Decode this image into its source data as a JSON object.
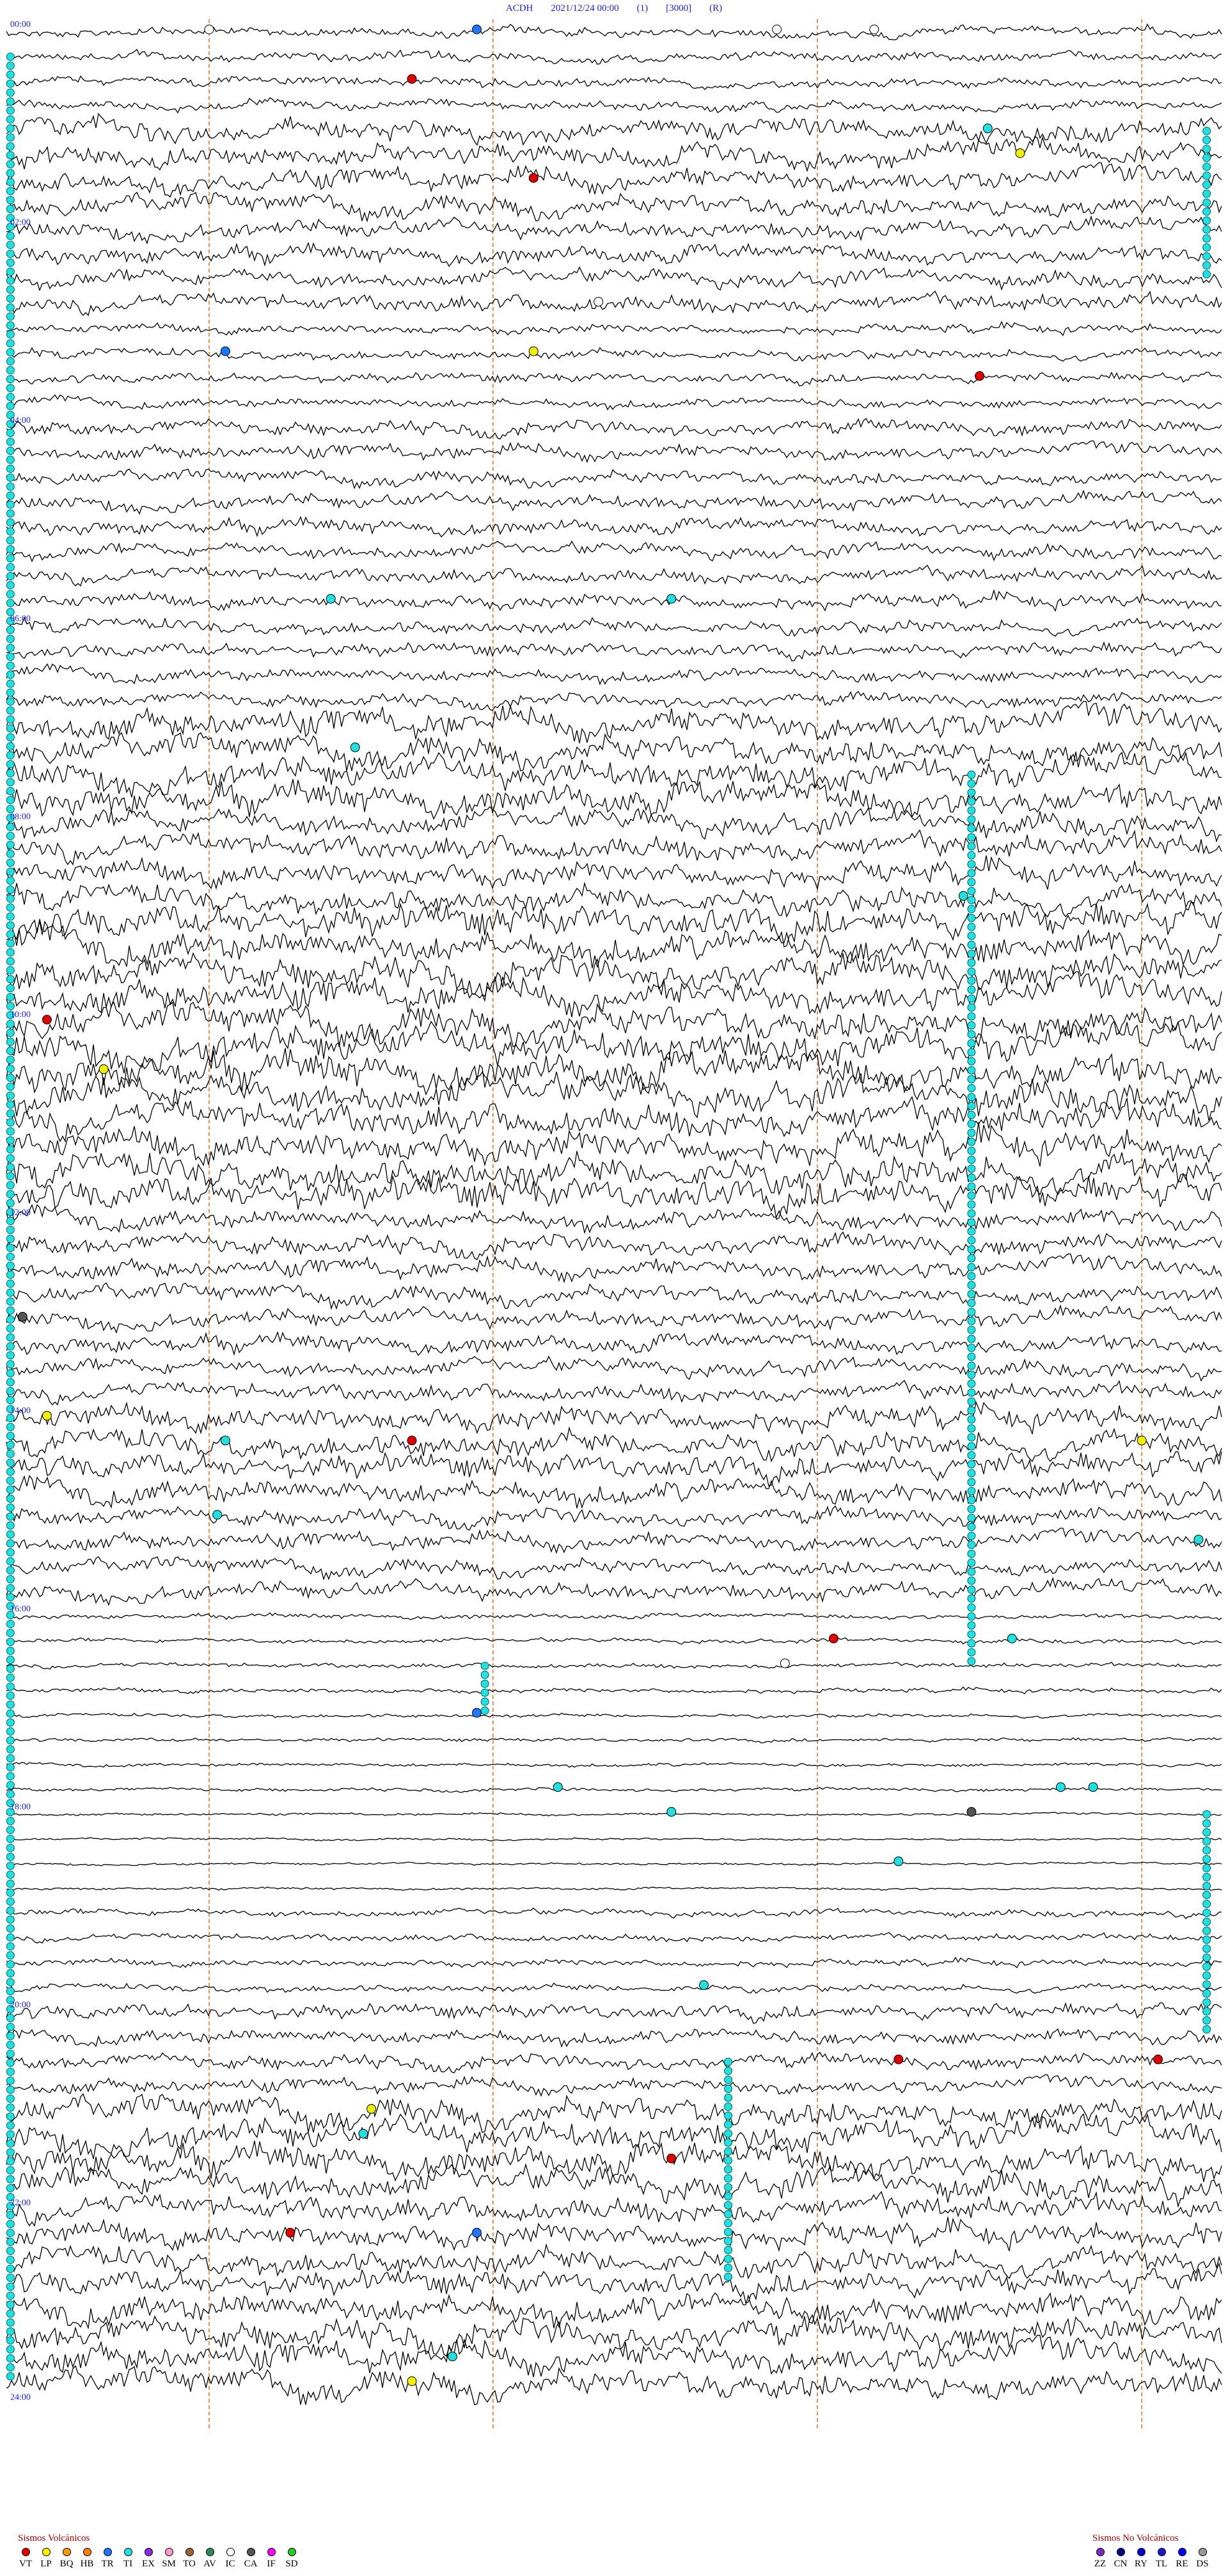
{
  "header": {
    "station": "ACDH",
    "datetime": "2021/12/24 00:00",
    "flag1": "(1)",
    "scale": "[3000]",
    "flag2": "(R)"
  },
  "chart_data": {
    "type": "line",
    "title": "",
    "xlabel": "",
    "ylabel": "",
    "hour_labels": [
      "00:00",
      "02:00",
      "04:00",
      "06:00",
      "08:00",
      "10:00",
      "12:00",
      "14:00",
      "16:00",
      "18:00",
      "20:00",
      "22:00",
      "24:00"
    ],
    "trace_count": 96,
    "minutes_per_trace": 15,
    "vertical_markers_minutes": [
      2.5,
      6,
      10,
      14
    ],
    "amplitude_profile": [
      {
        "hour": 0,
        "amplitude": 8
      },
      {
        "hour": 1,
        "amplitude": 18
      },
      {
        "hour": 2,
        "amplitude": 14
      },
      {
        "hour": 3,
        "amplitude": 8
      },
      {
        "hour": 4,
        "amplitude": 12
      },
      {
        "hour": 5,
        "amplitude": 12
      },
      {
        "hour": 6,
        "amplitude": 11
      },
      {
        "hour": 7,
        "amplitude": 24
      },
      {
        "hour": 8,
        "amplitude": 20
      },
      {
        "hour": 9,
        "amplitude": 26
      },
      {
        "hour": 10,
        "amplitude": 28
      },
      {
        "hour": 11,
        "amplitude": 26
      },
      {
        "hour": 12,
        "amplitude": 16
      },
      {
        "hour": 13,
        "amplitude": 14
      },
      {
        "hour": 14,
        "amplitude": 20
      },
      {
        "hour": 15,
        "amplitude": 14
      },
      {
        "hour": 16,
        "amplitude": 4
      },
      {
        "hour": 17,
        "amplitude": 3
      },
      {
        "hour": 18,
        "amplitude": 2
      },
      {
        "hour": 19,
        "amplitude": 6
      },
      {
        "hour": 20,
        "amplitude": 12
      },
      {
        "hour": 21,
        "amplitude": 24
      },
      {
        "hour": 22,
        "amplitude": 20
      },
      {
        "hour": 23,
        "amplitude": 24
      }
    ],
    "events": [
      {
        "type": "VT",
        "trace": 2,
        "minute": 5
      },
      {
        "type": "VT",
        "trace": 6,
        "minute": 6.5
      },
      {
        "type": "VT",
        "trace": 14,
        "minute": 12
      },
      {
        "type": "VT",
        "trace": 40,
        "minute": 0.5
      },
      {
        "type": "VT",
        "trace": 57,
        "minute": 5
      },
      {
        "type": "VT",
        "trace": 65,
        "minute": 10.2
      },
      {
        "type": "VT",
        "trace": 82,
        "minute": 11
      },
      {
        "type": "VT",
        "trace": 82,
        "minute": 14.2
      },
      {
        "type": "VT",
        "trace": 86,
        "minute": 8.2
      },
      {
        "type": "VT",
        "trace": 89,
        "minute": 3.5
      },
      {
        "type": "LP",
        "trace": 5,
        "minute": 12.5
      },
      {
        "type": "LP",
        "trace": 13,
        "minute": 6.5
      },
      {
        "type": "LP",
        "trace": 42,
        "minute": 1.2
      },
      {
        "type": "LP",
        "trace": 56,
        "minute": 0.5
      },
      {
        "type": "LP",
        "trace": 57,
        "minute": 14
      },
      {
        "type": "LP",
        "trace": 84,
        "minute": 4.5
      },
      {
        "type": "LP",
        "trace": 95,
        "minute": 5
      },
      {
        "type": "TR",
        "trace": 0,
        "minute": 5.8
      },
      {
        "type": "TR",
        "trace": 13,
        "minute": 2.7
      },
      {
        "type": "TR",
        "trace": 68,
        "minute": 5.8
      },
      {
        "type": "TR",
        "trace": 89,
        "minute": 5.8
      },
      {
        "type": "TI",
        "trace": 4,
        "minute": 12.1
      },
      {
        "type": "TI",
        "trace": 23,
        "minute": 4
      },
      {
        "type": "TI",
        "trace": 23,
        "minute": 8.2
      },
      {
        "type": "TI",
        "trace": 29,
        "minute": 4.3
      },
      {
        "type": "TI",
        "trace": 35,
        "minute": 11.8
      },
      {
        "type": "TI",
        "trace": 57,
        "minute": 2.7
      },
      {
        "type": "TI",
        "trace": 60,
        "minute": 2.6
      },
      {
        "type": "TI",
        "trace": 61,
        "minute": 14.7
      },
      {
        "type": "TI",
        "trace": 65,
        "minute": 12.4
      },
      {
        "type": "TI",
        "trace": 71,
        "minute": 6.8
      },
      {
        "type": "TI",
        "trace": 71,
        "minute": 13
      },
      {
        "type": "TI",
        "trace": 71,
        "minute": 13.4
      },
      {
        "type": "TI",
        "trace": 72,
        "minute": 8.2
      },
      {
        "type": "TI",
        "trace": 74,
        "minute": 11
      },
      {
        "type": "TI",
        "trace": 79,
        "minute": 8.6
      },
      {
        "type": "TI",
        "trace": 85,
        "minute": 4.4
      },
      {
        "type": "TI",
        "trace": 94,
        "minute": 5.5
      },
      {
        "type": "IC",
        "trace": 0,
        "minute": 2.5
      },
      {
        "type": "IC",
        "trace": 0,
        "minute": 9.5
      },
      {
        "type": "IC",
        "trace": 0,
        "minute": 10.7
      },
      {
        "type": "IC",
        "trace": 11,
        "minute": 7.3
      },
      {
        "type": "IC",
        "trace": 11,
        "minute": 12.9
      },
      {
        "type": "IC",
        "trace": 66,
        "minute": 9.6
      },
      {
        "type": "CA",
        "trace": 72,
        "minute": 11.9
      },
      {
        "type": "CA",
        "trace": 52,
        "minute": 0.2
      }
    ],
    "tremor_columns": [
      {
        "minute": 11.9,
        "from_trace": 30,
        "to_trace": 66
      },
      {
        "minute": 8.9,
        "from_trace": 82,
        "to_trace": 91
      },
      {
        "minute": 5.9,
        "from_trace": 66,
        "to_trace": 68
      },
      {
        "minute": 14.8,
        "from_trace": 72,
        "to_trace": 81
      },
      {
        "minute": 14.8,
        "from_trace": 4,
        "to_trace": 10
      },
      {
        "minute": 0.05,
        "from_trace": 1,
        "to_trace": 95
      }
    ]
  },
  "legend_volcanic": {
    "title": "Sismos Volcánicos",
    "items": [
      {
        "label": "VT",
        "color": "#e00000"
      },
      {
        "label": "LP",
        "color": "#f0f000"
      },
      {
        "label": "BQ",
        "color": "#ff9900"
      },
      {
        "label": "HB",
        "color": "#ff7f00"
      },
      {
        "label": "TR",
        "color": "#1f77ff"
      },
      {
        "label": "TI",
        "color": "#20e0e0"
      },
      {
        "label": "EX",
        "color": "#8a2be2"
      },
      {
        "label": "SM",
        "color": "#ff99cc"
      },
      {
        "label": "TO",
        "color": "#996633"
      },
      {
        "label": "AV",
        "color": "#2e8b57"
      },
      {
        "label": "IC",
        "color": "#ffffff"
      },
      {
        "label": "CA",
        "color": "#555555"
      },
      {
        "label": "IF",
        "color": "#ff00ff"
      },
      {
        "label": "SD",
        "color": "#22cc22"
      }
    ]
  },
  "legend_nonvolcanic": {
    "title": "Sismos No Volcánicos",
    "items": [
      {
        "label": "ZZ",
        "color": "#7b2fbe"
      },
      {
        "label": "CN",
        "color": "#000080"
      },
      {
        "label": "RY",
        "color": "#0000cc"
      },
      {
        "label": "TL",
        "color": "#1a1acc"
      },
      {
        "label": "RE",
        "color": "#0000ff"
      },
      {
        "label": "DS",
        "color": "#999999"
      }
    ]
  }
}
